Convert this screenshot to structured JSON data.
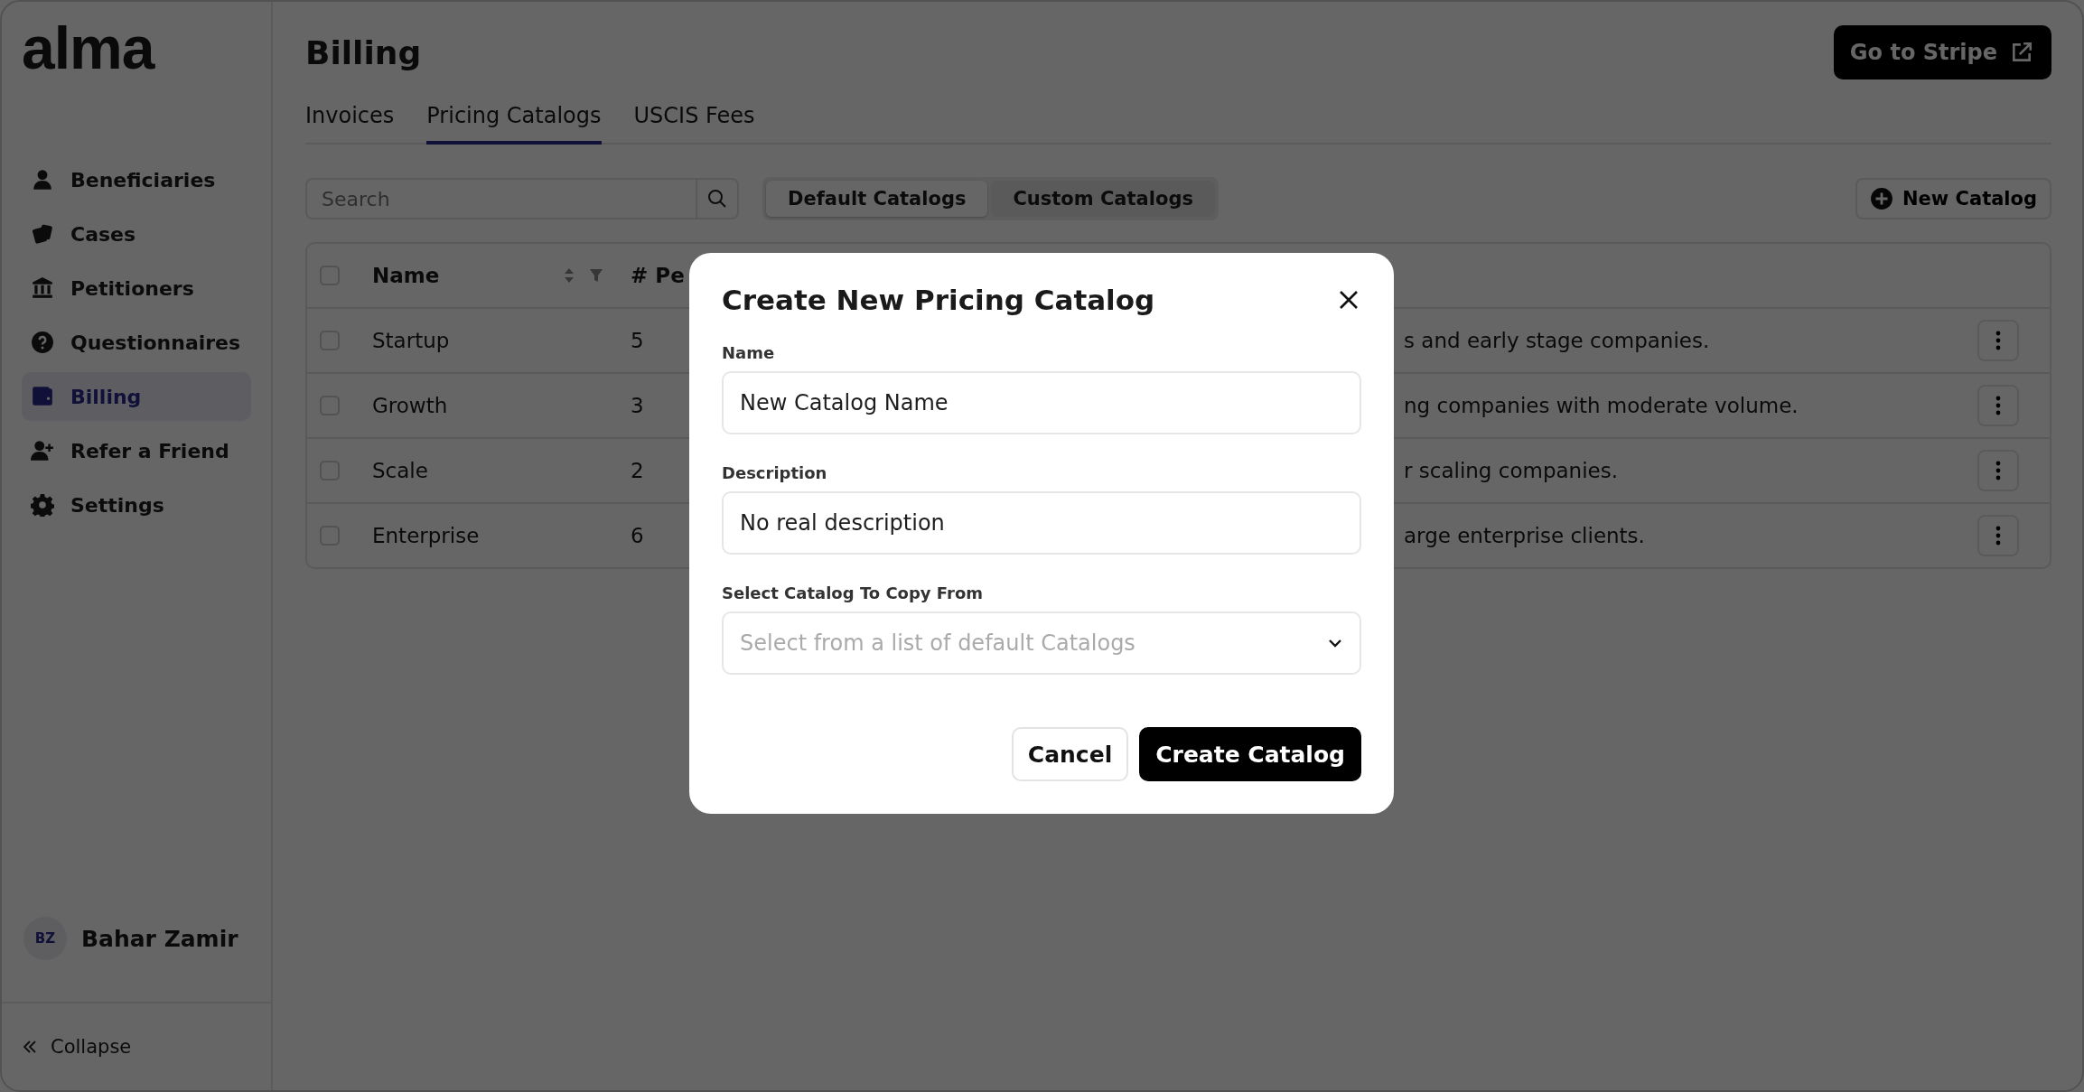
{
  "sidebar": {
    "logo": "alma",
    "items": [
      {
        "label": "Beneficiaries",
        "selected": false
      },
      {
        "label": "Cases",
        "selected": false
      },
      {
        "label": "Petitioners",
        "selected": false
      },
      {
        "label": "Questionnaires",
        "selected": false
      },
      {
        "label": "Billing",
        "selected": true
      },
      {
        "label": "Refer a Friend",
        "selected": false
      },
      {
        "label": "Settings",
        "selected": false
      }
    ],
    "user": {
      "initials": "BZ",
      "name": "Bahar Zamir"
    },
    "collapse": "Collapse"
  },
  "page": {
    "title": "Billing",
    "stripe_button": "Go to Stripe"
  },
  "tabs": [
    {
      "label": "Invoices",
      "selected": false
    },
    {
      "label": "Pricing Catalogs",
      "selected": true
    },
    {
      "label": "USCIS Fees",
      "selected": false
    }
  ],
  "search": {
    "placeholder": "Search"
  },
  "catalog_toggle": [
    {
      "label": "Default Catalogs",
      "selected": true
    },
    {
      "label": "Custom Catalogs",
      "selected": false
    }
  ],
  "new_button": "New Catalog",
  "table": {
    "select_all_checked": false,
    "columns": [
      "Name",
      "# Pe"
    ],
    "rows": [
      {
        "checked": false,
        "name": "Startup",
        "count": "5",
        "description": "s and early stage companies."
      },
      {
        "checked": false,
        "name": "Growth",
        "count": "3",
        "description": "ng companies with moderate volume."
      },
      {
        "checked": false,
        "name": "Scale",
        "count": "2",
        "description": "r scaling companies."
      },
      {
        "checked": false,
        "name": "Enterprise",
        "count": "6",
        "description": "arge enterprise clients."
      }
    ]
  },
  "dialog": {
    "title": "Create New Pricing Catalog",
    "fields": [
      {
        "kind": "text",
        "label": "Name",
        "value": "New Catalog Name"
      },
      {
        "kind": "text",
        "label": "Description",
        "value": "No real description"
      },
      {
        "kind": "select",
        "label": "Select Catalog To Copy From",
        "placeholder": "Select from a list of default Catalogs"
      }
    ],
    "buttons": [
      {
        "kind": "secondary",
        "label": "Cancel"
      },
      {
        "kind": "primary",
        "label": "Create Catalog"
      }
    ]
  }
}
